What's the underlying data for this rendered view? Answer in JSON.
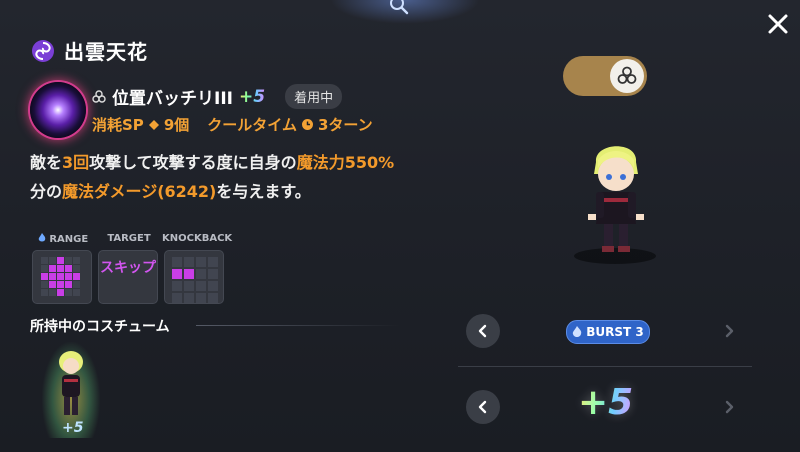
{
  "header": {
    "title": "出雲天花"
  },
  "skill": {
    "name": "位置バッチリIII",
    "plus": "+5",
    "status_badge": "着用中",
    "cost_label": "消耗SP",
    "cost_value": "9個",
    "cooldown_label": "クールタイム",
    "cooldown_value": "3ターン"
  },
  "description": {
    "p1": "敵を",
    "hits": "3回",
    "p2": "攻撃して攻撃する度に自身の",
    "stat": "魔法力",
    "percent": "550%",
    "p3": "分の",
    "dmg": "魔法ダメージ(6242)",
    "p4": "を与えます。"
  },
  "info": {
    "range_label": "RANGE",
    "target_label": "TARGET",
    "knockback_label": "KNOCKBACK",
    "target_value": "スキップ"
  },
  "costume": {
    "label": "所持中のコスチューム",
    "plus": "+5"
  },
  "selector": {
    "burst_label": "BURST 3",
    "plus_value": "+5"
  },
  "colors": {
    "accent_orange": "#f39a2b",
    "accent_purple": "#c93ee6",
    "toggle_gold": "#a7844c",
    "burst_blue": "#2f64c8"
  },
  "icons": [
    "search-icon",
    "close-icon",
    "swirl-icon",
    "clover-icon",
    "diamond-icon",
    "clock-icon",
    "flame-icon",
    "chevron-left-icon",
    "chevron-right-icon",
    "toggle-clover-icon"
  ]
}
